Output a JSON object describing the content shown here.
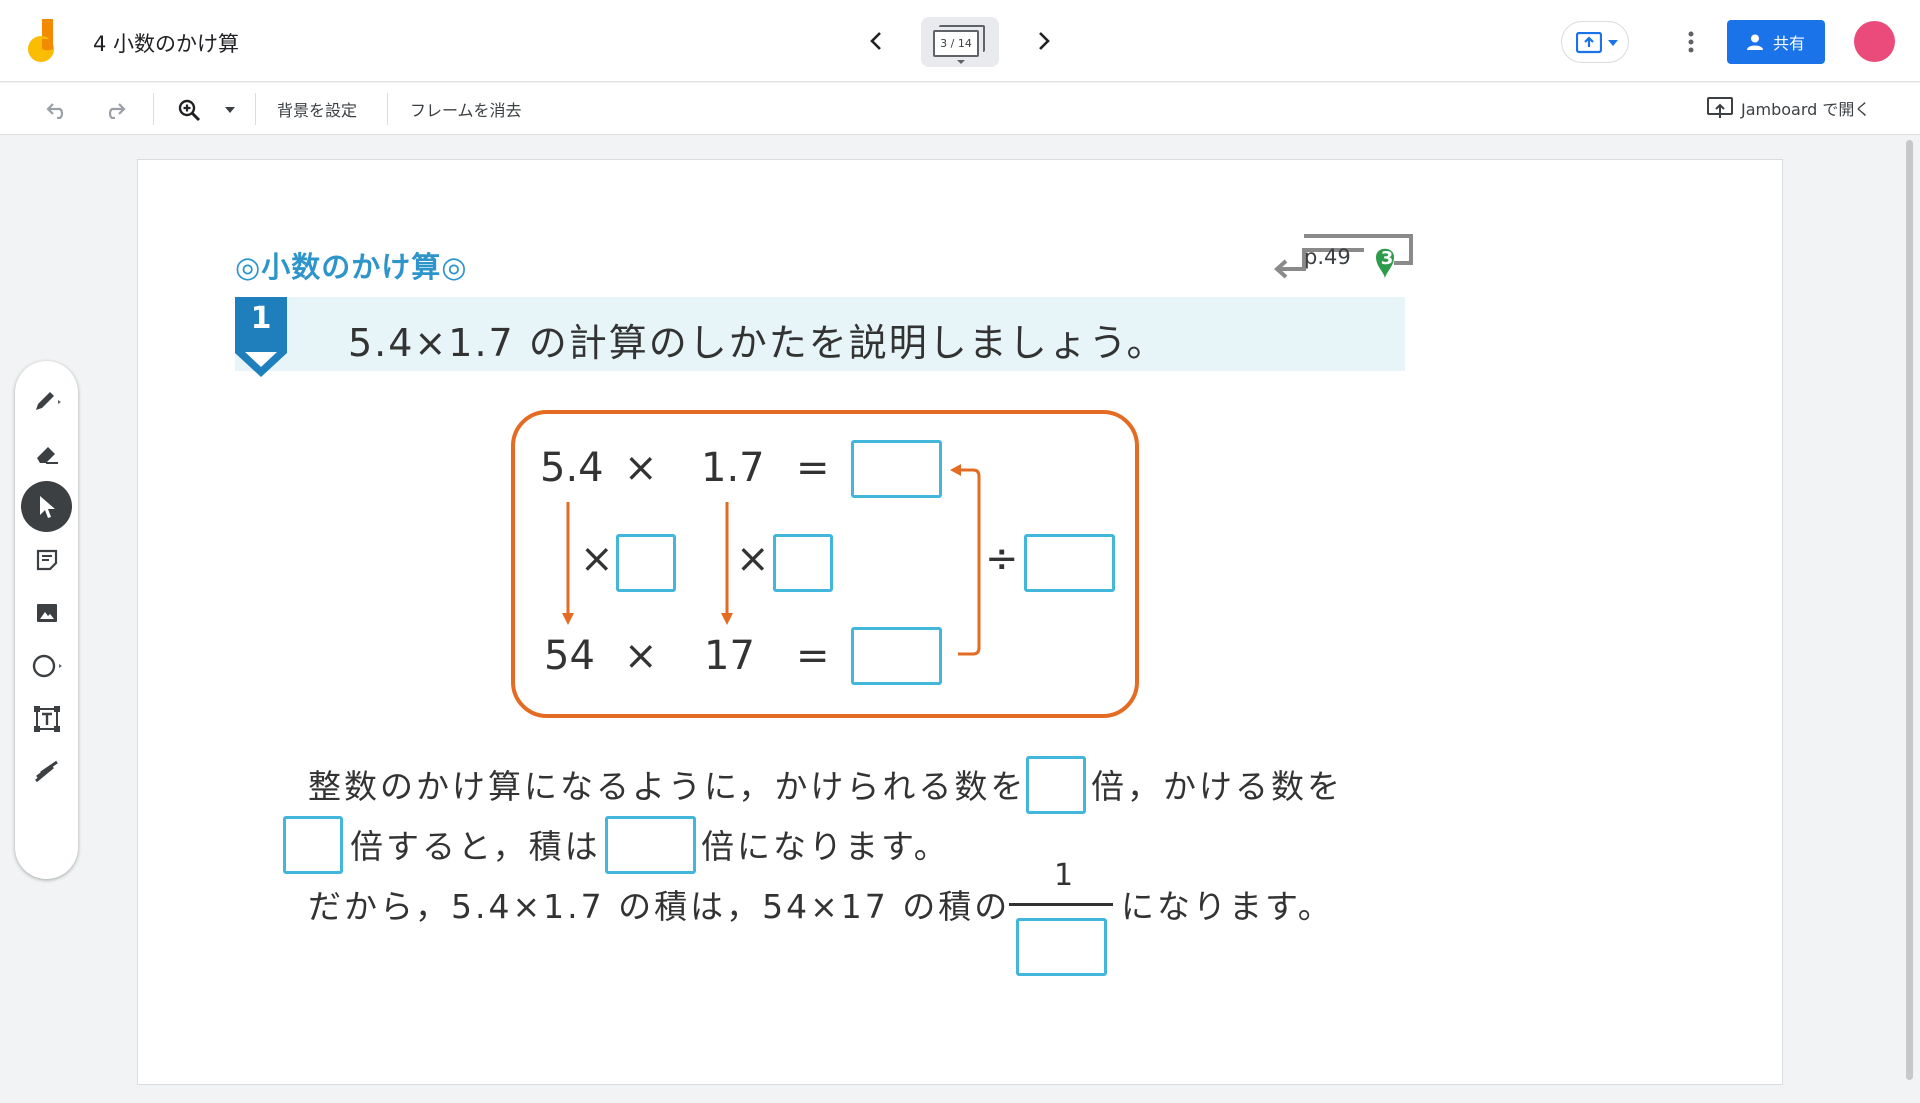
{
  "app": {
    "doc_title": "4 小数のかけ算",
    "frame_indicator": "3 / 14",
    "share_label": "共有",
    "open_in_jamboard": "Jamboard で開く"
  },
  "toolbar": {
    "set_background": "背景を設定",
    "clear_frame": "フレームを消去"
  },
  "tools": [
    "pen",
    "eraser",
    "select",
    "sticky-note",
    "image",
    "circle",
    "text-box",
    "laser"
  ],
  "colors": {
    "accent": "#1a73e8",
    "avatar": "#ea4b7a",
    "orange": "#e36b23",
    "blank_border": "#43b6dc",
    "title_blue": "#2d95c9"
  },
  "worksheet": {
    "title": "◎小数のかけ算◎",
    "page_ref": "p.49",
    "page_ref_badge": "3",
    "problem_number": "1",
    "problem_text": "5.4×1.7 の計算のしかたを説明しましょう。",
    "calc": {
      "row1_a": "5.4",
      "times": "×",
      "row1_b": "1.7",
      "equals": "=",
      "row2_a": "54",
      "row2_b": "17",
      "divide": "÷"
    },
    "line1_a": "整数のかけ算になるように，かけられる数を",
    "line1_b": "倍，かける数を",
    "line2_a": "倍すると，積は",
    "line2_b": "倍になります。",
    "line3_a": "だから，5.4×1.7 の積は，54×17 の積の",
    "line3_num": "1",
    "line3_b": "になります。"
  }
}
